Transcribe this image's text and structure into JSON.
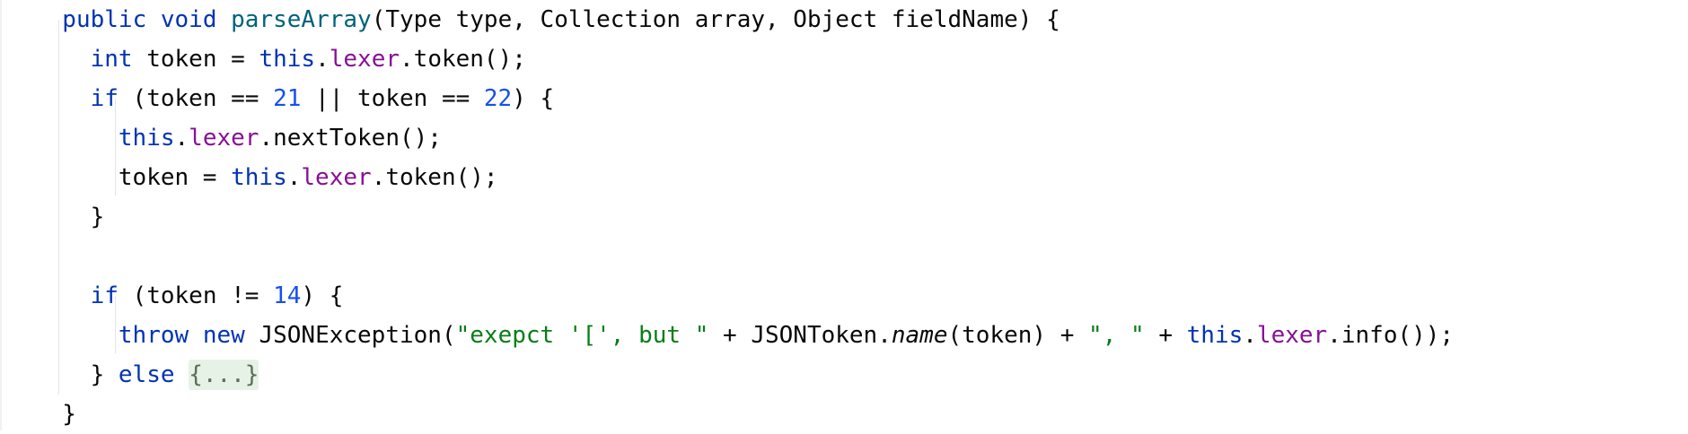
{
  "lines": [
    {
      "indent": "  ",
      "tokens": [
        {
          "t": "public",
          "c": "kw"
        },
        {
          "t": " "
        },
        {
          "t": "void",
          "c": "kw"
        },
        {
          "t": " "
        },
        {
          "t": "parseArray",
          "c": "fn"
        },
        {
          "t": "(Type type, Collection array, Object fieldName) {"
        }
      ]
    },
    {
      "indent": "    ",
      "tokens": [
        {
          "t": "int",
          "c": "kw"
        },
        {
          "t": " token = "
        },
        {
          "t": "this",
          "c": "kw"
        },
        {
          "t": "."
        },
        {
          "t": "lexer",
          "c": "field"
        },
        {
          "t": ".token();"
        }
      ]
    },
    {
      "indent": "    ",
      "tokens": [
        {
          "t": "if",
          "c": "kw"
        },
        {
          "t": " (token == "
        },
        {
          "t": "21",
          "c": "num"
        },
        {
          "t": " || token == "
        },
        {
          "t": "22",
          "c": "num"
        },
        {
          "t": ") {"
        }
      ]
    },
    {
      "indent": "      ",
      "tokens": [
        {
          "t": "this",
          "c": "kw"
        },
        {
          "t": "."
        },
        {
          "t": "lexer",
          "c": "field"
        },
        {
          "t": ".nextToken();"
        }
      ]
    },
    {
      "indent": "      ",
      "tokens": [
        {
          "t": "token = "
        },
        {
          "t": "this",
          "c": "kw"
        },
        {
          "t": "."
        },
        {
          "t": "lexer",
          "c": "field"
        },
        {
          "t": ".token();"
        }
      ]
    },
    {
      "indent": "    ",
      "tokens": [
        {
          "t": "}"
        }
      ]
    },
    {
      "indent": "",
      "tokens": []
    },
    {
      "indent": "    ",
      "tokens": [
        {
          "t": "if",
          "c": "kw"
        },
        {
          "t": " (token != "
        },
        {
          "t": "14",
          "c": "num"
        },
        {
          "t": ") {"
        }
      ]
    },
    {
      "indent": "      ",
      "tokens": [
        {
          "t": "throw",
          "c": "kw"
        },
        {
          "t": " "
        },
        {
          "t": "new",
          "c": "kw"
        },
        {
          "t": " JSONException("
        },
        {
          "t": "\"exepct '[', but \"",
          "c": "str"
        },
        {
          "t": " + JSONToken."
        },
        {
          "t": "name",
          "c": "ital"
        },
        {
          "t": "(token) + "
        },
        {
          "t": "\", \"",
          "c": "str"
        },
        {
          "t": " + "
        },
        {
          "t": "this",
          "c": "kw"
        },
        {
          "t": "."
        },
        {
          "t": "lexer",
          "c": "field"
        },
        {
          "t": ".info());"
        }
      ]
    },
    {
      "indent": "    ",
      "tokens": [
        {
          "t": "} "
        },
        {
          "t": "else",
          "c": "kw"
        },
        {
          "t": " "
        },
        {
          "t": "{...}",
          "c": "fold"
        }
      ]
    },
    {
      "indent": "  ",
      "tokens": [
        {
          "t": "}"
        }
      ]
    }
  ]
}
